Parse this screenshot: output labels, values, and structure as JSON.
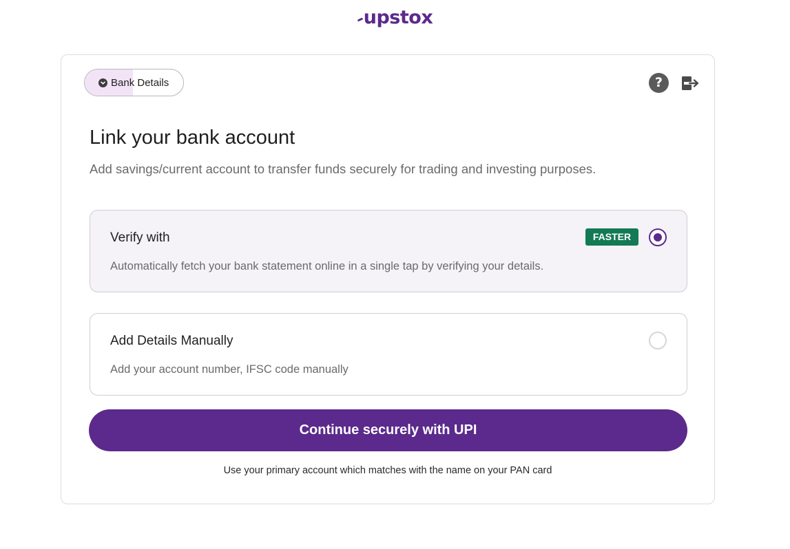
{
  "brand": {
    "logo_text": "upstox",
    "accent": "#5b2a8c"
  },
  "progress": {
    "label_part1": "Bank",
    "label_part2": " Details",
    "icon": "chevron-down-icon",
    "fill_fraction": 0.49
  },
  "header_icons": {
    "help": "?",
    "help_icon": "question-circle-icon",
    "logout_icon": "logout-icon"
  },
  "page": {
    "title": "Link your bank account",
    "subtitle": "Add savings/current account to transfer funds securely for trading and investing purposes."
  },
  "options": [
    {
      "title": "Verify with",
      "badge": "FASTER",
      "badge_color": "#137a55",
      "description": "Automatically fetch your bank statement online in a single tap by verifying your details.",
      "selected": true
    },
    {
      "title": "Add Details Manually",
      "description": "Add your account number, IFSC code manually",
      "selected": false
    }
  ],
  "cta": {
    "label": "Continue securely with UPI"
  },
  "note": "Use your primary account which matches with the name on your PAN card"
}
